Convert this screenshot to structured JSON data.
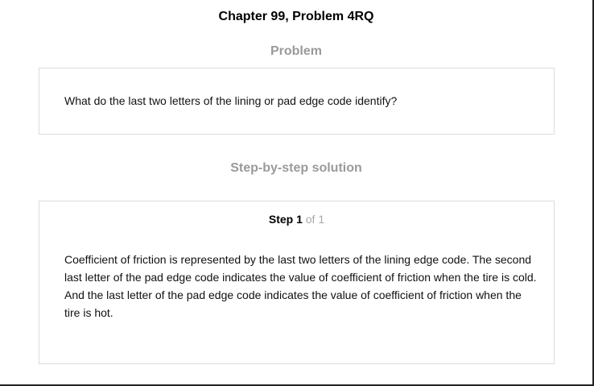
{
  "header": {
    "title": "Chapter 99, Problem 4RQ"
  },
  "problem": {
    "heading": "Problem",
    "text": "What do the last two letters of the lining or pad edge code identify?"
  },
  "solution": {
    "heading": "Step-by-step solution",
    "step_label": "Step 1",
    "step_of": "of 1",
    "text": "Coefficient of friction is represented by the last two letters of the lining edge code. The second last letter of the pad edge code indicates the value of coefficient of friction when the tire is cold. And the last letter of the pad edge code indicates the value of coefficient of friction when the tire is hot."
  }
}
